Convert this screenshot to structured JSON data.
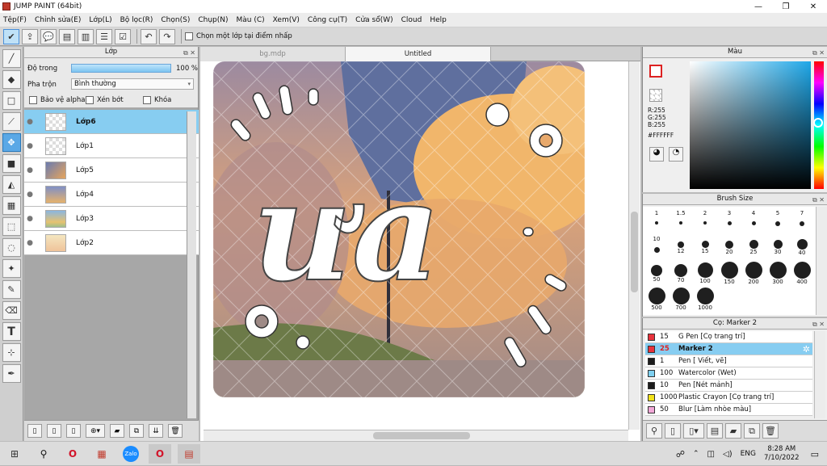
{
  "window": {
    "title": "JUMP PAINT (64bit)",
    "minimize": "—",
    "maximize": "❐",
    "close": "✕"
  },
  "menu": [
    "Tệp(F)",
    "Chỉnh sửa(E)",
    "Lớp(L)",
    "Bộ lọc(R)",
    "Chọn(S)",
    "Chụp(N)",
    "Màu (C)",
    "Xem(V)",
    "Công cụ(T)",
    "Cửa sổ(W)",
    "Cloud",
    "Help"
  ],
  "toolbar": {
    "snap_label": "Chọn một lớp tại điểm nhấp"
  },
  "layer_panel": {
    "title": "Lớp",
    "opacity_label": "Độ trong",
    "opacity_value": "100 %",
    "opacity_level": 100,
    "blend_label": "Pha trộn",
    "blend_value": "Bình thường",
    "protect_alpha": "Bảo vệ alpha",
    "clip": "Xén bớt",
    "lock": "Khóa",
    "layers": [
      {
        "name": "Lớp6",
        "selected": true
      },
      {
        "name": "Lớp1"
      },
      {
        "name": "Lớp5"
      },
      {
        "name": "Lớp4"
      },
      {
        "name": "Lớp3"
      },
      {
        "name": "Lớp2"
      }
    ]
  },
  "canvas": {
    "tabs": [
      "bg.mdp",
      "Untitled"
    ],
    "active_tab": 1,
    "artwork_text": "ưa"
  },
  "color_panel": {
    "title": "Màu",
    "r": "R:255",
    "g": "G:255",
    "b": "B:255",
    "hex": "#FFFFFF"
  },
  "brush_size": {
    "title": "Brush Size",
    "sizes": [
      "1",
      "1.5",
      "2",
      "3",
      "4",
      "5",
      "7",
      "10",
      "12",
      "15",
      "20",
      "25",
      "30",
      "40",
      "50",
      "70",
      "100",
      "150",
      "200",
      "300",
      "400",
      "500",
      "700",
      "1000"
    ]
  },
  "brush_panel": {
    "title": "Cọ: Marker 2",
    "brushes": [
      {
        "size": "15",
        "name": "G Pen [Cọ trang trí]",
        "color": "#e8323c"
      },
      {
        "size": "25",
        "name": "Marker 2",
        "color": "#e8323c",
        "selected": true
      },
      {
        "size": "1",
        "name": "Pen [ Viết, vẽ]",
        "color": "#1c1c1c"
      },
      {
        "size": "100",
        "name": "Watercolor (Wet)",
        "color": "#7fd0f0"
      },
      {
        "size": "10",
        "name": "Pen [Nét mảnh]",
        "color": "#1c1c1c"
      },
      {
        "size": "1000",
        "name": "Plastic Crayon [Cọ trang trí]",
        "color": "#f2e21a"
      },
      {
        "size": "50",
        "name": "Blur [Làm nhòe màu]",
        "color": "#f2a8d8"
      }
    ]
  },
  "taskbar": {
    "lang": "ENG",
    "time": "8:28 AM",
    "date": "7/10/2022",
    "zalo": "Zalo"
  },
  "colors": {
    "accent": "#87cdf1",
    "selected_tool": "#5aa8e6"
  }
}
